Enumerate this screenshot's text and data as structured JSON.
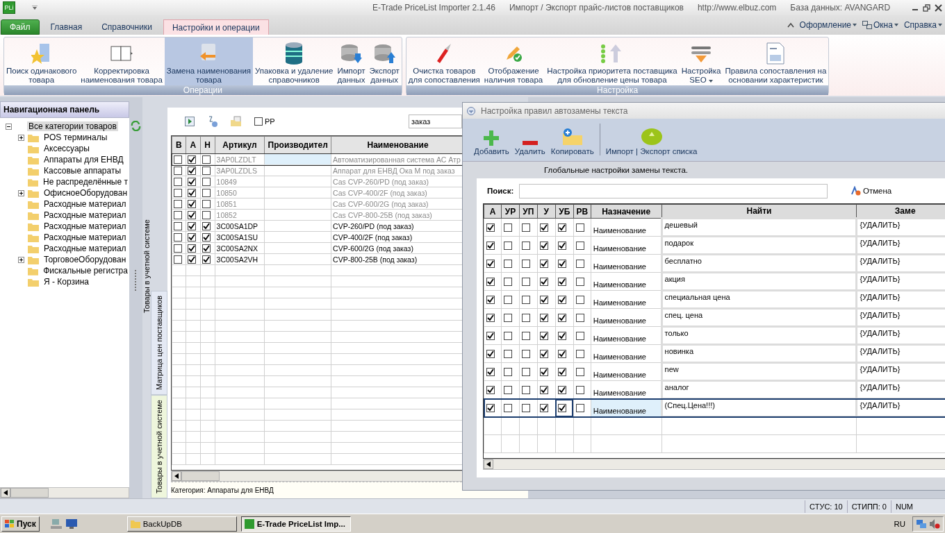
{
  "window": {
    "app_logo": "PLi",
    "title": "E-Trade PriceList Importer 2.1.46",
    "subtitle": "Импорт / Экспорт прайс-листов поставщиков",
    "url": "http://www.elbuz.com",
    "database": "База данных: AVANGARD"
  },
  "ribbon": {
    "tabs": [
      {
        "label": "Файл",
        "kind": "file",
        "selected": false
      },
      {
        "label": "Главная",
        "kind": "tab",
        "selected": false
      },
      {
        "label": "Справочники",
        "kind": "tab",
        "selected": false
      },
      {
        "label": "Настройки и операции",
        "kind": "tab",
        "selected": true
      }
    ],
    "menus": [
      {
        "label": "Оформление",
        "kind": "plain"
      },
      {
        "label": "Окна",
        "kind": "windows"
      },
      {
        "label": "Справка",
        "kind": "plain"
      }
    ],
    "groups": [
      {
        "title": "Операции",
        "buttons": [
          {
            "label": "Поиск одинакового\nтовара",
            "selected": false
          },
          {
            "label": "Корректировка\nнаименования товара",
            "selected": false
          },
          {
            "label": "Замена наименования\nтовара",
            "selected": true
          },
          {
            "label": "Упаковка и удаление\nсправочников",
            "selected": false
          },
          {
            "label": "Импорт\nданных",
            "selected": false
          },
          {
            "label": "Экспорт\nданных",
            "selected": false
          }
        ]
      },
      {
        "title": "Настройка",
        "buttons": [
          {
            "label": "Очистка товаров\nдля сопоставления",
            "selected": false
          },
          {
            "label": "Отображение\nналичия товара",
            "selected": false
          },
          {
            "label": "Настройка приоритета поставщика\nдля обновление цены товара",
            "selected": false
          },
          {
            "label": "Настройка\nSEO",
            "selected": false,
            "dropdown": true
          },
          {
            "label": "Правила сопоставления на\nосновании характеристик",
            "selected": false
          }
        ]
      }
    ]
  },
  "nav_panel": {
    "title": "Навигационная панель",
    "tree": [
      {
        "label": "Все категории товаров",
        "selected": true,
        "expanded": true,
        "children": [
          {
            "label": "POS терминалы",
            "expandable": true,
            "selected": false
          },
          {
            "label": "Аксессуары",
            "expandable": false,
            "selected": false
          },
          {
            "label": "Аппараты для ЕНВД",
            "expandable": false,
            "selected": false
          },
          {
            "label": "Кассовые аппараты",
            "expandable": false,
            "selected": false
          },
          {
            "label": "Не распределённые т",
            "expandable": false,
            "selected": false
          },
          {
            "label": "ОфисноеОборудован",
            "expandable": true,
            "selected": false
          },
          {
            "label": "Расходные материал",
            "expandable": false,
            "selected": false
          },
          {
            "label": "Расходные материал",
            "expandable": false,
            "selected": false
          },
          {
            "label": "Расходные материал",
            "expandable": false,
            "selected": false
          },
          {
            "label": "Расходные материал",
            "expandable": false,
            "selected": false
          },
          {
            "label": "Расходные материал",
            "expandable": false,
            "selected": false
          },
          {
            "label": "ТорговоеОборудован",
            "expandable": true,
            "selected": false
          },
          {
            "label": "Фискальные регистра",
            "expandable": false,
            "selected": false
          },
          {
            "label": "Я - Корзина",
            "expandable": false,
            "selected": false
          }
        ]
      }
    ]
  },
  "middle_panel": {
    "back_label": "Товары в учетной системе",
    "tabs": [
      {
        "label": "Матрица цен поставщиков",
        "selected": false
      },
      {
        "label": "Товары в учетной системе",
        "selected": true
      }
    ],
    "pp_checkbox": {
      "label": "РР",
      "checked": false
    },
    "search": {
      "value": "заказ"
    },
    "grid": {
      "columns": [
        "В",
        "А",
        "Н",
        "Артикул",
        "Производител",
        "Наименование"
      ],
      "rows": [
        {
          "v": false,
          "a": true,
          "n": false,
          "article": "3AP0LZDLT",
          "name": "Автоматизированная система АС Атр",
          "greyed": true,
          "selected": true
        },
        {
          "v": false,
          "a": true,
          "n": false,
          "article": "3AP0LZDLS",
          "name": "Аппарат для ЕНВД Ока М под заказ",
          "greyed": true,
          "selected": false
        },
        {
          "v": false,
          "a": true,
          "n": false,
          "article": "10849",
          "name": "Cas CVP-260/PD (под заказ)",
          "greyed": true,
          "selected": false
        },
        {
          "v": false,
          "a": true,
          "n": false,
          "article": "10850",
          "name": "Cas CVP-400/2F (под заказ)",
          "greyed": true,
          "selected": false
        },
        {
          "v": false,
          "a": true,
          "n": false,
          "article": "10851",
          "name": "Cas CVP-600/2G (под заказ)",
          "greyed": true,
          "selected": false
        },
        {
          "v": false,
          "a": true,
          "n": false,
          "article": "10852",
          "name": "Cas CVP-800-25B (под заказ)",
          "greyed": true,
          "selected": false
        },
        {
          "v": false,
          "a": true,
          "n": true,
          "article": "3C00SA1DP",
          "name": "CVP-260/PD (под заказ)",
          "greyed": false,
          "selected": false
        },
        {
          "v": false,
          "a": true,
          "n": true,
          "article": "3C00SA1SU",
          "name": "CVP-400/2F (под заказ)",
          "greyed": false,
          "selected": false
        },
        {
          "v": false,
          "a": true,
          "n": true,
          "article": "3C00SA2NX",
          "name": "CVP-600/2G (под заказ)",
          "greyed": false,
          "selected": false
        },
        {
          "v": false,
          "a": true,
          "n": true,
          "article": "3C00SA2VH",
          "name": "CVP-800-25B (под заказ)",
          "greyed": false,
          "selected": false
        }
      ]
    },
    "footer": "Категория: Аппараты для ЕНВД"
  },
  "dialog": {
    "title": "Настройка правил автозамены текста",
    "toolbar": [
      {
        "label": "Добавить",
        "kind": "add"
      },
      {
        "label": "Удалить",
        "kind": "remove"
      },
      {
        "label": "Копировать",
        "kind": "copy"
      },
      {
        "label": "Импорт | Экспорт списка",
        "kind": "io"
      }
    ],
    "caption": "Глобальные настройки замены текста.",
    "search_label": "Поиск:",
    "cancel": "Отмена",
    "grid": {
      "columns": [
        "А",
        "УР",
        "УП",
        "У",
        "УБ",
        "РВ",
        "Назначение",
        "Найти",
        "Заме"
      ],
      "rows": [
        {
          "a": true,
          "ur": false,
          "up": false,
          "u": true,
          "ub": true,
          "rv": false,
          "target": "Наименование",
          "find": "дешевый",
          "replace": "{УДАЛИТЬ}",
          "selected": false
        },
        {
          "a": true,
          "ur": false,
          "up": false,
          "u": true,
          "ub": true,
          "rv": false,
          "target": "Наименование",
          "find": "подарок",
          "replace": "{УДАЛИТЬ}",
          "selected": false
        },
        {
          "a": true,
          "ur": false,
          "up": false,
          "u": true,
          "ub": true,
          "rv": false,
          "target": "Наименование",
          "find": "бесплатно",
          "replace": "{УДАЛИТЬ}",
          "selected": false
        },
        {
          "a": true,
          "ur": false,
          "up": false,
          "u": true,
          "ub": true,
          "rv": false,
          "target": "Наименование",
          "find": "акция",
          "replace": "{УДАЛИТЬ}",
          "selected": false
        },
        {
          "a": true,
          "ur": false,
          "up": false,
          "u": true,
          "ub": true,
          "rv": false,
          "target": "Наименование",
          "find": "специальная цена",
          "replace": "{УДАЛИТЬ}",
          "selected": false
        },
        {
          "a": true,
          "ur": false,
          "up": false,
          "u": true,
          "ub": true,
          "rv": false,
          "target": "Наименование",
          "find": "спец. цена",
          "replace": "{УДАЛИТЬ}",
          "selected": false
        },
        {
          "a": true,
          "ur": false,
          "up": false,
          "u": true,
          "ub": true,
          "rv": false,
          "target": "Наименование",
          "find": "только",
          "replace": "{УДАЛИТЬ}",
          "selected": false
        },
        {
          "a": true,
          "ur": false,
          "up": false,
          "u": true,
          "ub": true,
          "rv": false,
          "target": "Наименование",
          "find": "новинка",
          "replace": "{УДАЛИТЬ}",
          "selected": false
        },
        {
          "a": true,
          "ur": false,
          "up": false,
          "u": true,
          "ub": true,
          "rv": false,
          "target": "Наименование",
          "find": "new",
          "replace": "{УДАЛИТЬ}",
          "selected": false
        },
        {
          "a": true,
          "ur": false,
          "up": false,
          "u": true,
          "ub": true,
          "rv": false,
          "target": "Наименование",
          "find": "аналог",
          "replace": "{УДАЛИТЬ}",
          "selected": false
        },
        {
          "a": true,
          "ur": false,
          "up": false,
          "u": true,
          "ub": true,
          "rv": false,
          "target": "Наименование",
          "find": "(Спец.Цена!!!)",
          "replace": "{УДАЛИТЬ}",
          "selected": true
        }
      ]
    }
  },
  "status_bar": [
    "СТУС: 10",
    "СТИПП: 0",
    "NUM"
  ],
  "taskbar": {
    "start": "Пуск",
    "tasks": [
      {
        "label": "BackUpDB",
        "selected": false
      },
      {
        "label": "E-Trade PriceList Imp...",
        "selected": true
      }
    ],
    "language": "RU"
  }
}
